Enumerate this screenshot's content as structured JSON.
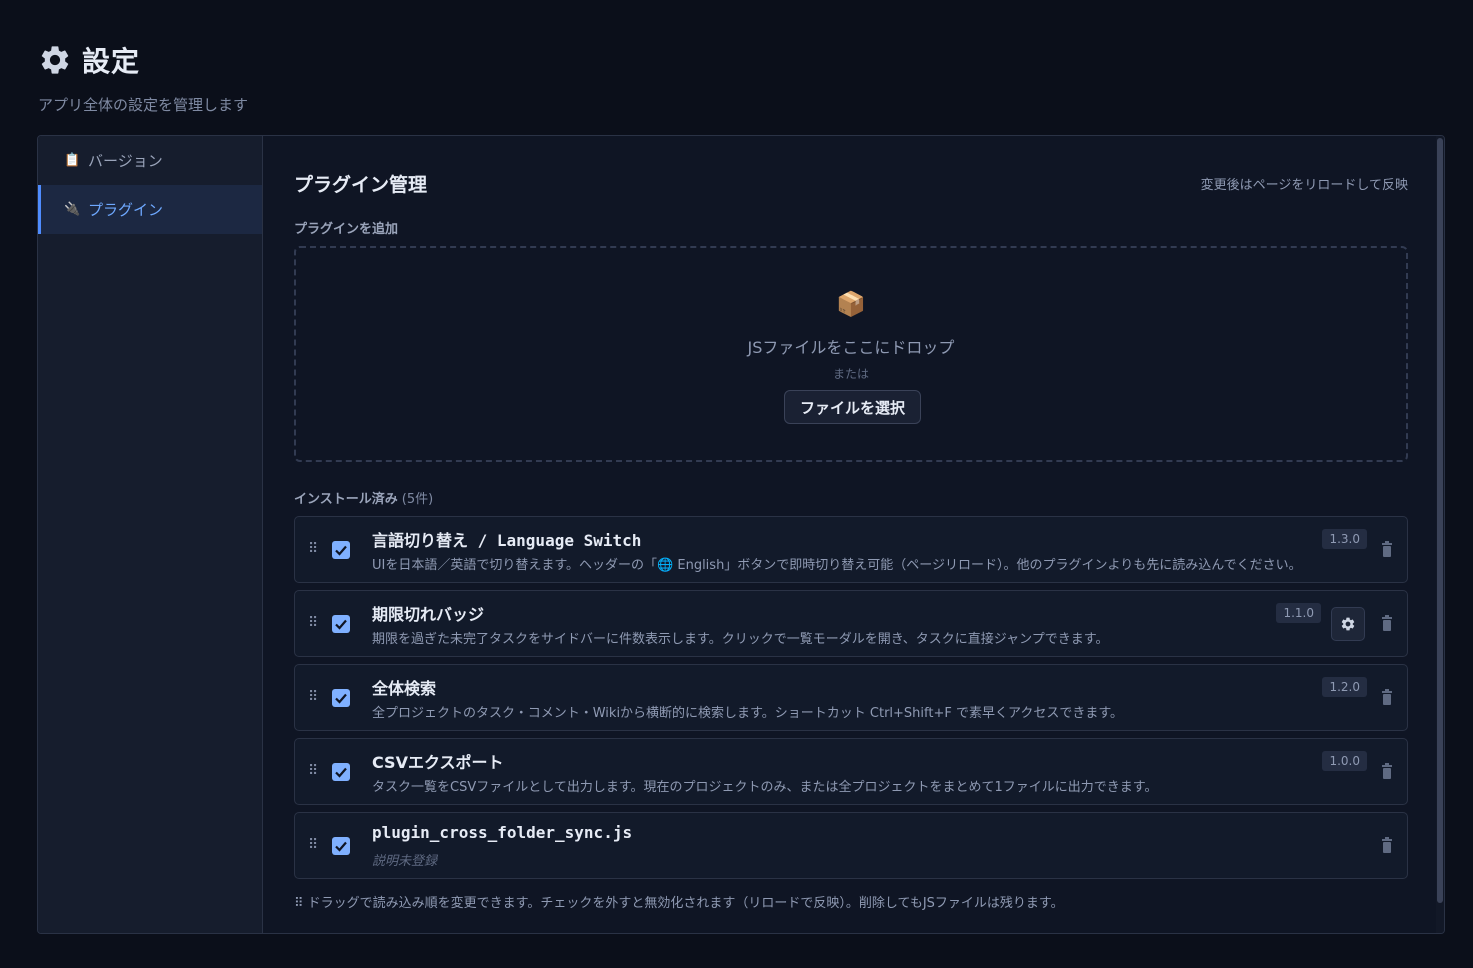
{
  "header": {
    "title": "設定",
    "subtitle": "アプリ全体の設定を管理します",
    "icon": "gear-icon"
  },
  "sidebar": {
    "items": [
      {
        "label": "バージョン",
        "icon": "📋",
        "active": false
      },
      {
        "label": "プラグイン",
        "icon": "🔌",
        "active": true
      }
    ]
  },
  "content": {
    "title": "プラグイン管理",
    "reload_note": "変更後はページをリロードして反映",
    "add_label": "プラグインを追加",
    "dropzone": {
      "icon": "📦",
      "text": "JSファイルをここにドロップ",
      "or": "または",
      "button": "ファイルを選択"
    },
    "installed_label": "インストール済み",
    "installed_count": "(5件)",
    "footer_note": "⠿ ドラッグで読み込み順を変更できます。チェックを外すと無効化されます（リロードで反映）。削除してもJSファイルは残ります。"
  },
  "plugins": [
    {
      "name": "言語切り替え / Language Switch",
      "desc": "UIを日本語／英語で切り替えます。ヘッダーの「🌐 English」ボタンで即時切り替え可能（ページリロード）。他のプラグインよりも先に読み込んでください。",
      "version": "1.3.0",
      "enabled": true,
      "has_settings": false
    },
    {
      "name": "期限切れバッジ",
      "desc": "期限を過ぎた未完了タスクをサイドバーに件数表示します。クリックで一覧モーダルを開き、タスクに直接ジャンプできます。",
      "version": "1.1.0",
      "enabled": true,
      "has_settings": true
    },
    {
      "name": "全体検索",
      "desc": "全プロジェクトのタスク・コメント・Wikiから横断的に検索します。ショートカット Ctrl+Shift+F で素早くアクセスできます。",
      "version": "1.2.0",
      "enabled": true,
      "has_settings": false
    },
    {
      "name": "CSVエクスポート",
      "desc": "タスク一覧をCSVファイルとして出力します。現在のプロジェクトのみ、または全プロジェクトをまとめて1ファイルに出力できます。",
      "version": "1.0.0",
      "enabled": true,
      "has_settings": false
    },
    {
      "name": "plugin_cross_folder_sync.js",
      "desc": "説明未登録",
      "version": "",
      "enabled": true,
      "has_settings": false
    }
  ],
  "colors": {
    "accent": "#4f8cff",
    "checkbox": "#7fb0ff",
    "background": "#0b0f1a"
  }
}
